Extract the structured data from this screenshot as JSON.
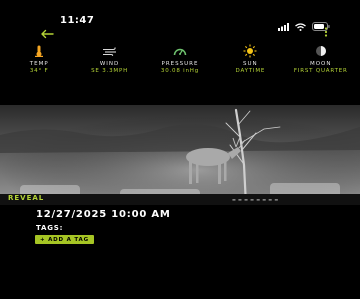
{
  "status_bar": {
    "time": "11:47"
  },
  "stats": [
    {
      "icon": "thermometer-icon",
      "label": "TEMP",
      "value": "34° F"
    },
    {
      "icon": "wind-icon",
      "label": "WIND",
      "value": "SE 3.3MPH"
    },
    {
      "icon": "gauge-icon",
      "label": "PRESSURE",
      "value": "30.08 inHg"
    },
    {
      "icon": "sun-icon",
      "label": "SUN",
      "value": "DAYTIME"
    },
    {
      "icon": "moon-phase-icon",
      "label": "MOON",
      "value": "FIRST QUARTER"
    }
  ],
  "photo": {
    "brand": "REVEAL"
  },
  "detail": {
    "datetime": "12/27/2025 10:00 AM",
    "tags_label": "TAGS:",
    "add_tag_label": "+ ADD A TAG"
  },
  "colors": {
    "accent": "#b4d336",
    "background": "#000000"
  }
}
